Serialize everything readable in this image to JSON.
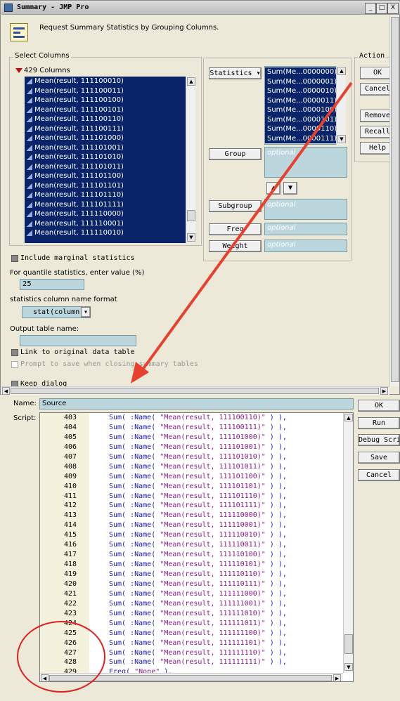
{
  "window": {
    "title": "Summary - JMP Pro",
    "description": "Request Summary Statistics by Grouping Columns.",
    "min_btn": "_",
    "max_btn": "□",
    "close_btn": "X"
  },
  "select_columns": {
    "legend": "Select Columns",
    "count_label": "429 Columns",
    "items": [
      "Mean(result, 111100010)",
      "Mean(result, 111100011)",
      "Mean(result, 111100100)",
      "Mean(result, 111100101)",
      "Mean(result, 111100110)",
      "Mean(result, 111100111)",
      "Mean(result, 111101000)",
      "Mean(result, 111101001)",
      "Mean(result, 111101010)",
      "Mean(result, 111101011)",
      "Mean(result, 111101100)",
      "Mean(result, 111101101)",
      "Mean(result, 111101110)",
      "Mean(result, 111101111)",
      "Mean(result, 111110000)",
      "Mean(result, 111110001)",
      "Mean(result, 111110010)"
    ]
  },
  "roles": {
    "statistics_label": "Statistics",
    "statistics_items": [
      "Sum(Me...0000000)",
      "Sum(Me...0000001)",
      "Sum(Me...0000010)",
      "Sum(Me...0000011)",
      "Sum(Me...0000100)",
      "Sum(Me...0000101)",
      "Sum(Me...0000110)",
      "Sum(Me...0000111)"
    ],
    "group_label": "Group",
    "group_placeholder": "optional",
    "subgroup_label": "Subgroup",
    "subgroup_placeholder": "optional",
    "freq_label": "Freq",
    "freq_placeholder": "optional",
    "weight_label": "Weight",
    "weight_placeholder": "optional"
  },
  "action": {
    "legend": "Action",
    "ok": "OK",
    "cancel": "Cancel",
    "remove": "Remove",
    "recall": "Recall",
    "help": "Help"
  },
  "options": {
    "include_marginal": "Include marginal statistics",
    "quantile_label": "For quantile statistics, enter value (%)",
    "quantile_value": "25",
    "format_label": "statistics column name format",
    "format_value": "stat(column)",
    "output_label": "Output table name:",
    "output_value": "",
    "link_label": "Link to original data table",
    "prompt_label": "Prompt to save when closing summary tables",
    "keep_label": "Keep dialog open"
  },
  "script_editor": {
    "name_label": "Name:",
    "name_value": "Source",
    "script_label": "Script:",
    "buttons": {
      "ok": "OK",
      "run": "Run",
      "debug": "Debug Script",
      "save": "Save",
      "cancel": "Cancel"
    },
    "lines": [
      {
        "n": "403",
        "pre": "Sum( :Name( ",
        "str": "\"Mean(result, 111100110)\"",
        "post": " ) ),"
      },
      {
        "n": "404",
        "pre": "Sum( :Name( ",
        "str": "\"Mean(result, 111100111)\"",
        "post": " ) ),"
      },
      {
        "n": "405",
        "pre": "Sum( :Name( ",
        "str": "\"Mean(result, 111101000)\"",
        "post": " ) ),"
      },
      {
        "n": "406",
        "pre": "Sum( :Name( ",
        "str": "\"Mean(result, 111101001)\"",
        "post": " ) ),"
      },
      {
        "n": "407",
        "pre": "Sum( :Name( ",
        "str": "\"Mean(result, 111101010)\"",
        "post": " ) ),"
      },
      {
        "n": "408",
        "pre": "Sum( :Name( ",
        "str": "\"Mean(result, 111101011)\"",
        "post": " ) ),"
      },
      {
        "n": "409",
        "pre": "Sum( :Name( ",
        "str": "\"Mean(result, 111101100)\"",
        "post": " ) ),"
      },
      {
        "n": "410",
        "pre": "Sum( :Name( ",
        "str": "\"Mean(result, 111101101)\"",
        "post": " ) ),"
      },
      {
        "n": "411",
        "pre": "Sum( :Name( ",
        "str": "\"Mean(result, 111101110)\"",
        "post": " ) ),"
      },
      {
        "n": "412",
        "pre": "Sum( :Name( ",
        "str": "\"Mean(result, 111101111)\"",
        "post": " ) ),"
      },
      {
        "n": "413",
        "pre": "Sum( :Name( ",
        "str": "\"Mean(result, 111110000)\"",
        "post": " ) ),"
      },
      {
        "n": "414",
        "pre": "Sum( :Name( ",
        "str": "\"Mean(result, 111110001)\"",
        "post": " ) ),"
      },
      {
        "n": "415",
        "pre": "Sum( :Name( ",
        "str": "\"Mean(result, 111110010)\"",
        "post": " ) ),"
      },
      {
        "n": "416",
        "pre": "Sum( :Name( ",
        "str": "\"Mean(result, 111110011)\"",
        "post": " ) ),"
      },
      {
        "n": "417",
        "pre": "Sum( :Name( ",
        "str": "\"Mean(result, 111110100)\"",
        "post": " ) ),"
      },
      {
        "n": "418",
        "pre": "Sum( :Name( ",
        "str": "\"Mean(result, 111110101)\"",
        "post": " ) ),"
      },
      {
        "n": "419",
        "pre": "Sum( :Name( ",
        "str": "\"Mean(result, 111110110)\"",
        "post": " ) ),"
      },
      {
        "n": "420",
        "pre": "Sum( :Name( ",
        "str": "\"Mean(result, 111110111)\"",
        "post": " ) ),"
      },
      {
        "n": "421",
        "pre": "Sum( :Name( ",
        "str": "\"Mean(result, 111111000)\"",
        "post": " ) ),"
      },
      {
        "n": "422",
        "pre": "Sum( :Name( ",
        "str": "\"Mean(result, 111111001)\"",
        "post": " ) ),"
      },
      {
        "n": "423",
        "pre": "Sum( :Name( ",
        "str": "\"Mean(result, 111111010)\"",
        "post": " ) ),"
      },
      {
        "n": "424",
        "pre": "Sum( :Name( ",
        "str": "\"Mean(result, 111111011)\"",
        "post": " ) ),"
      },
      {
        "n": "425",
        "pre": "Sum( :Name( ",
        "str": "\"Mean(result, 111111100)\"",
        "post": " ) ),"
      },
      {
        "n": "426",
        "pre": "Sum( :Name( ",
        "str": "\"Mean(result, 111111101)\"",
        "post": " ) ),"
      },
      {
        "n": "427",
        "pre": "Sum( :Name( ",
        "str": "\"Mean(result, 111111110)\"",
        "post": " ) ),"
      },
      {
        "n": "428",
        "pre": "Sum( :Name( ",
        "str": "\"Mean(result, 111111111)\"",
        "post": " ) ),"
      },
      {
        "n": "429",
        "pre": "Freq( ",
        "str": "\"None\"",
        "post": " ),"
      }
    ]
  },
  "colors": {
    "annotation_red": "#e8402f",
    "selection_navy": "#0a246a",
    "field_teal": "#bcd6de"
  }
}
